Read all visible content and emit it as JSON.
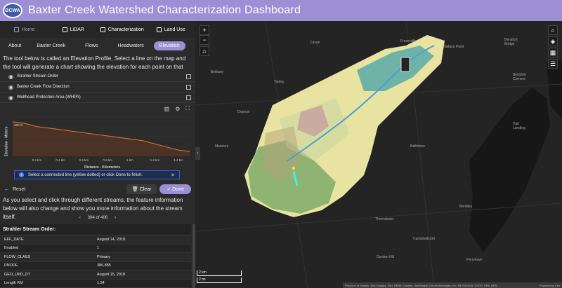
{
  "header": {
    "logo_text": "BCWA",
    "title": "Baxter Creek Watershed Characterization Dashboard"
  },
  "main_nav": [
    {
      "label": "Home",
      "icon": "home-icon"
    },
    {
      "label": "LiDAR",
      "icon": "lidar-icon"
    },
    {
      "label": "Characterization",
      "icon": "document-icon"
    },
    {
      "label": "Land Use",
      "icon": "document-icon"
    }
  ],
  "sub_tabs": [
    "About",
    "Baxter Creek",
    "Flows",
    "Headwaters",
    "Elevation"
  ],
  "description": "The tool below is called an Elevation Profile. Select a line on the map and the tool will generate a chart showing the elevation for each point on that line.",
  "layers": [
    "Strahler Stream Order",
    "Baxter Creek Flow Direction",
    "Wellhead Protection Area (WHPA)"
  ],
  "chart_data": {
    "type": "line",
    "ylabel": "Elevation - Meters",
    "xlabel": "Distance - Kilometers",
    "y_tick": "280 m",
    "x_ticks": [
      "0.2 km",
      "0.4 km",
      "0.6 km",
      "0.8 km",
      "1 km",
      "1.2 km",
      "1.4 km"
    ],
    "x": [
      0,
      0.1,
      0.2,
      0.3,
      0.4,
      0.5,
      0.6,
      0.7,
      0.8,
      0.9,
      1.0,
      1.1,
      1.2,
      1.3,
      1.4,
      1.5
    ],
    "y": [
      282,
      281,
      279,
      278,
      277,
      276,
      275,
      274,
      273,
      272,
      271,
      270,
      268,
      266,
      264,
      263
    ],
    "color": "#e8762c"
  },
  "toast": "Select a connected line (yellow dotted) or click Done to finish.",
  "actions": {
    "reset": "Reset",
    "clear": "Clear",
    "done": "Done"
  },
  "description2": "As you select and click through different streams, the feature information below will also change and show you more information about the stream itself.",
  "pager": {
    "text": "394 of 406"
  },
  "attributes": {
    "title": "Strahler Stream Order:",
    "rows": [
      {
        "k": "EFF_DATE",
        "v": "August 14, 2018"
      },
      {
        "k": "Enabled",
        "v": "1"
      },
      {
        "k": "FLOW_CLASS",
        "v": "Primary"
      },
      {
        "k": "PNODE",
        "v": "386,885"
      },
      {
        "k": "GEO_UPD_DT",
        "v": "August 15, 2018"
      },
      {
        "k": "Length KM",
        "v": "1.54"
      }
    ]
  },
  "map": {
    "places": [
      {
        "n": "Cavan"
      },
      {
        "n": "Fraserville"
      },
      {
        "n": "Wallace Point"
      },
      {
        "n": "Bensfort Bridge"
      },
      {
        "n": "Bethany"
      },
      {
        "n": "Taplay"
      },
      {
        "n": "Bensfort Corners"
      },
      {
        "n": "Drancel"
      },
      {
        "n": "Hall Landing"
      },
      {
        "n": "Manvers"
      },
      {
        "n": "Ballintore"
      },
      {
        "n": "Thornstown"
      },
      {
        "n": "Bendley"
      },
      {
        "n": "Campbellcroft"
      },
      {
        "n": "Garden Hill"
      },
      {
        "n": "Perrytown"
      }
    ],
    "scale_km": "2 km",
    "scale_mi": "2 mi",
    "attribution": "Province of Ontario, Esri Canada, Esri, HERE, Garmin, SafeGraph, GeoTechnologies, Inc, METI/NASA, USGS, EPA, NPS...",
    "powered": "Powered by Esri"
  }
}
